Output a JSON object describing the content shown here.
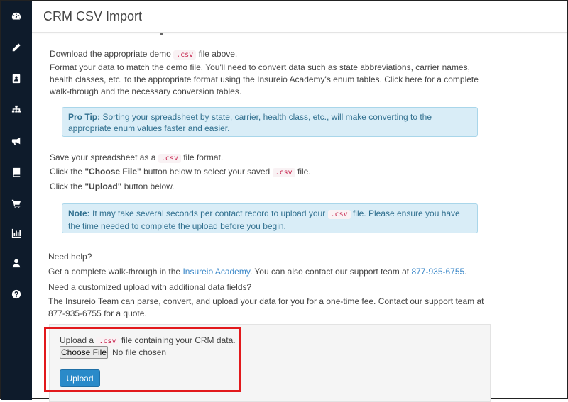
{
  "page": {
    "title": "CRM CSV Import"
  },
  "sidebar": {
    "icons": [
      "dashboard-icon",
      "pencil-icon",
      "contacts-icon",
      "sitemap-icon",
      "bullhorn-icon",
      "book-icon",
      "cart-icon",
      "bar-chart-icon",
      "user-icon",
      "help-icon"
    ]
  },
  "steps": {
    "download_pre": "Download the appropriate demo",
    "download_code": ".csv",
    "download_post": "file above.",
    "format_text": "Format your data to match the demo file. You'll need to convert data such as state abbreviations, carrier names, health classes, etc. to the appropriate format using the Insureio Academy's enum tables. Click here for a complete walk-through and the necessary conversion tables.",
    "pro_tip_label": "Pro Tip:",
    "pro_tip_text": "Sorting your spreadsheet by state, carrier, health class, etc., will make converting to the appropriate enum values faster and easier.",
    "save_pre": "Save your spreadsheet as a",
    "save_code": ".csv",
    "save_post": "file format.",
    "choose_pre": "Click the",
    "choose_bold": "\"Choose File\"",
    "choose_mid": "button below to select your saved",
    "choose_code": ".csv",
    "choose_post": "file.",
    "upload_pre": "Click the",
    "upload_bold": "\"Upload\"",
    "upload_post": "button below.",
    "note_label": "Note:",
    "note_pre": "It may take several seconds per contact record to upload your",
    "note_code": ".csv",
    "note_post": "file. Please ensure you have the time needed to complete the upload before you begin."
  },
  "help": {
    "need_help": "Need help?",
    "walkthrough_pre": "Get a complete walk-through in the",
    "academy_link": "Insureio Academy",
    "walkthrough_mid": ". You can also contact our support team at",
    "phone_link": "877-935-6755",
    "walkthrough_post": ".",
    "custom_question": "Need a customized upload with additional data fields?",
    "custom_text": "The Insureio Team can parse, convert, and upload your data for you for a one-time fee. Contact our support team at 877-935-6755 for a quote."
  },
  "upload": {
    "instruction_pre": "Upload a",
    "instruction_code": ".csv",
    "instruction_post": "file containing your CRM data.",
    "choose_file_label": "Choose File",
    "no_file_text": "No file chosen",
    "upload_label": "Upload"
  },
  "colors": {
    "sidebar_bg": "#0e1b2b",
    "info_bg": "#d9edf7",
    "link": "#3a87c8",
    "primary_button": "#2a8ac9",
    "highlight": "#e2191c"
  }
}
